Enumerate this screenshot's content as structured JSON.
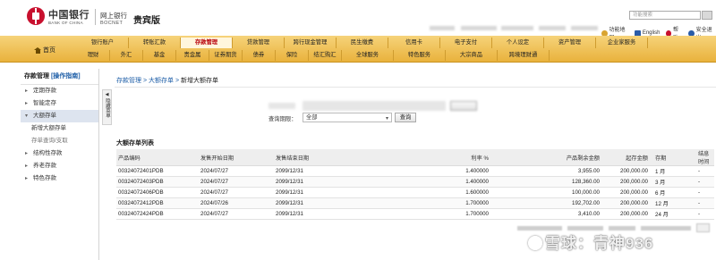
{
  "header": {
    "bank_name_cn": "中国银行",
    "bank_name_en": "BANK OF CHINA",
    "ebank_cn": "网上银行",
    "ebank_en": "BOCNET",
    "edition": "贵宾版",
    "search_placeholder": "功能搜索",
    "links": [
      {
        "label": "功能地图",
        "color": "#d9a431"
      },
      {
        "label": "English",
        "color": "#2a5ca8"
      },
      {
        "label": "帮助",
        "color": "#c8102e"
      },
      {
        "label": "安全退出",
        "color": "#2a5ca8"
      }
    ]
  },
  "nav": {
    "home": "首页",
    "row1": [
      "银行账户",
      "转账汇款",
      "存款管理",
      "贷款管理",
      "跨行现金管理",
      "民生缴费",
      "信用卡",
      "电子支付",
      "个人设定",
      "资产管理",
      "企业家服务"
    ],
    "row2": [
      "理财",
      "外汇",
      "基金",
      "贵金属",
      "证券期货",
      "债券",
      "保险",
      "结汇购汇",
      "全球服务",
      "特色服务",
      "大宗商品",
      "跨境理财通"
    ],
    "active": "存款管理"
  },
  "sidebar": {
    "title": "存款管理",
    "guide": "[操作指南]",
    "items": [
      {
        "label": "定期存款",
        "arrow": "▸"
      },
      {
        "label": "智能定存",
        "arrow": "▸"
      },
      {
        "label": "大额存单",
        "arrow": "▾"
      },
      {
        "label": "新增大额存单"
      },
      {
        "label": "存单查询/支取"
      },
      {
        "label": "结构性存款",
        "arrow": "▸"
      },
      {
        "label": "养老存款",
        "arrow": "▸"
      },
      {
        "label": "特色存款",
        "arrow": "▸"
      }
    ],
    "collapse": "隐藏菜单"
  },
  "breadcrumb": {
    "l1": "存款管理",
    "l2": "大额存单",
    "l3": "新增大额存单",
    "sep": ">"
  },
  "form": {
    "period_label": "查询期限：",
    "period_value": "全部",
    "query_button": "查询"
  },
  "list": {
    "title": "大额存单列表",
    "columns": [
      "产品编码",
      "发售开始日期",
      "发售结束日期",
      "利率 %",
      "产品剩余金额",
      "起存金额",
      "存期",
      "结息时间"
    ],
    "rows": [
      [
        "00324072401PDB",
        "2024/07/27",
        "2099/12/31",
        "1.400000",
        "3,955.00",
        "200,000.00",
        "1 月",
        "-"
      ],
      [
        "00324072403PDB",
        "2024/07/27",
        "2099/12/31",
        "1.400000",
        "128,360.00",
        "200,000.00",
        "3 月",
        "-"
      ],
      [
        "00324072406PDB",
        "2024/07/27",
        "2099/12/31",
        "1.600000",
        "100,000.00",
        "200,000.00",
        "6 月",
        "-"
      ],
      [
        "00324072412PDB",
        "2024/07/26",
        "2099/12/31",
        "1.700000",
        "192,702.00",
        "200,000.00",
        "12 月",
        "-"
      ],
      [
        "00324072424PDB",
        "2024/07/27",
        "2099/12/31",
        "1.700000",
        "3,410.00",
        "200,000.00",
        "24 月",
        "-"
      ]
    ]
  },
  "watermark": "雪球：青神936"
}
